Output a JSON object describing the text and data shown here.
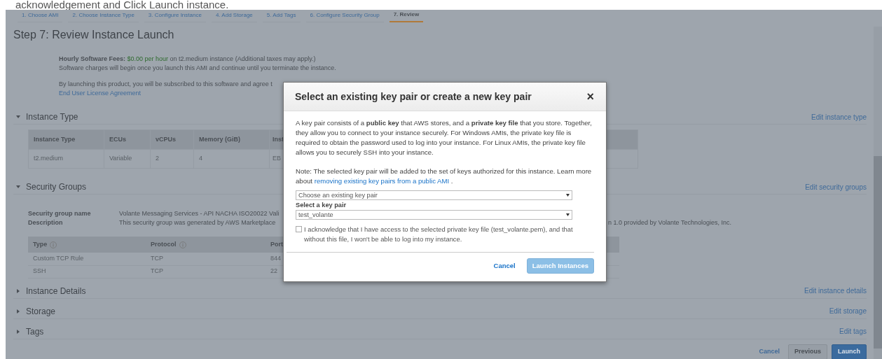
{
  "banner": {
    "text": "acknowledgement and Click Launch instance."
  },
  "wizard_steps": [
    {
      "label": "1. Choose AMI",
      "selected": false
    },
    {
      "label": "2. Choose Instance Type",
      "selected": false
    },
    {
      "label": "3. Configure Instance",
      "selected": false
    },
    {
      "label": "4. Add Storage",
      "selected": false
    },
    {
      "label": "5. Add Tags",
      "selected": false
    },
    {
      "label": "6. Configure Security Group",
      "selected": false
    },
    {
      "label": "7. Review",
      "selected": true
    }
  ],
  "page_title": "Step 7: Review Instance Launch",
  "software_fees": {
    "label": "Hourly Software Fees:",
    "price": "$0.00 per hour",
    "details": "on t2.medium instance (Additional taxes may apply.)",
    "note": "Software charges will begin once you launch this AMI and continue until you terminate the instance.",
    "subscription": "By launching this product, you will be subscribed to this software and agree t",
    "eula_link": "End User License Agreement"
  },
  "sections": [
    {
      "kind": "instance_type",
      "title": "Instance Type",
      "expanded": true,
      "edit_link": "Edit instance type",
      "table": {
        "columns": [
          "Instance Type",
          "ECUs",
          "vCPUs",
          "Memory (GiB)",
          "Inst"
        ],
        "rows": [
          [
            "t2.medium",
            "Variable",
            "2",
            "4",
            "EB"
          ]
        ]
      }
    },
    {
      "kind": "security_groups",
      "title": "Security Groups",
      "expanded": true,
      "edit_link": "Edit security groups",
      "fields": [
        {
          "label": "Security group name",
          "value": "Volante Messaging Services - API NACHA ISO20022 Vali"
        },
        {
          "label": "Description",
          "value": "This security group was generated by AWS Marketplace",
          "value_end": "n 1.0 provided by Volante Technologies, Inc."
        }
      ],
      "table": {
        "columns": [
          {
            "label": "Type",
            "info": true
          },
          {
            "label": "Protocol",
            "info": true
          },
          {
            "label": "Port",
            "info": false
          }
        ],
        "rows": [
          [
            "Custom TCP Rule",
            "TCP",
            "844"
          ],
          [
            "SSH",
            "TCP",
            "22"
          ]
        ]
      }
    },
    {
      "kind": "plain",
      "title": "Instance Details",
      "expanded": false,
      "edit_link": "Edit instance details"
    },
    {
      "kind": "plain",
      "title": "Storage",
      "expanded": false,
      "edit_link": "Edit storage"
    },
    {
      "kind": "plain",
      "title": "Tags",
      "expanded": false,
      "edit_link": "Edit tags"
    }
  ],
  "footer": {
    "cancel": "Cancel",
    "previous": "Previous",
    "launch": "Launch"
  },
  "modal": {
    "title": "Select an existing key pair or create a new key pair",
    "close": "×",
    "intro": "A key pair consists of a **public key** that AWS stores, and a **private key file** that you store. Together, they allow you to connect to your instance securely. For Windows AMIs, the private key file is required to obtain the password used to log into your instance. For Linux AMIs, the private key file allows you to securely SSH into your instance.",
    "note": "Note: The selected key pair will be added to the set of keys authorized for this instance. Learn more about ",
    "note_link": "removing existing key pairs from a public AMI",
    "note_end": " .",
    "mode_select": "Choose an existing key pair",
    "key_label": "Select a key pair",
    "key_select": "test_volante",
    "acknowledge": {
      "text": "I acknowledge that I have access to the selected private key file (test_volante.pem), and that without this file, I won't be able to log into my instance.",
      "checked": false
    },
    "cancel": "Cancel",
    "launch": {
      "label": "Launch Instances",
      "disabled": true
    }
  }
}
